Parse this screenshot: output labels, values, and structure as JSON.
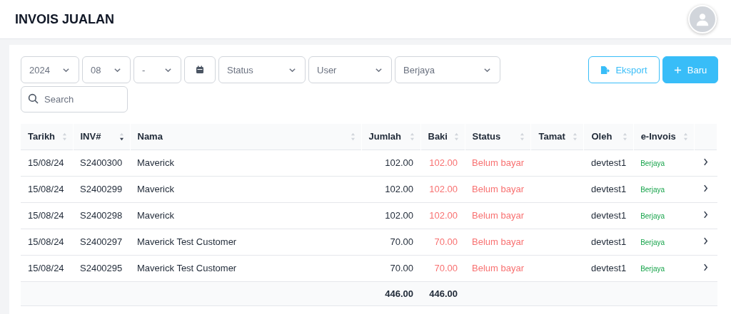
{
  "header": {
    "title": "INVOIS JUALAN"
  },
  "filters": [
    {
      "kind": "select",
      "value": "2024"
    },
    {
      "kind": "select",
      "value": "08"
    },
    {
      "kind": "select",
      "value": "-"
    },
    {
      "kind": "date"
    },
    {
      "kind": "select",
      "placeholder": "Status"
    },
    {
      "kind": "select",
      "placeholder": "User"
    },
    {
      "kind": "select",
      "value": "Berjaya"
    }
  ],
  "buttons": [
    {
      "kind": "outline",
      "label": "Eksport"
    },
    {
      "kind": "primary",
      "label": "Baru"
    }
  ],
  "search": {
    "placeholder": "Search"
  },
  "table": {
    "columns": [
      {
        "label": "Tarikh",
        "sorted_desc": false
      },
      {
        "label": "INV#",
        "sorted_desc": true
      },
      {
        "label": "Nama",
        "sorted_desc": false
      },
      {
        "label": "Jumlah",
        "sorted_desc": false
      },
      {
        "label": "Baki",
        "sorted_desc": false
      },
      {
        "label": "Status",
        "sorted_desc": false
      },
      {
        "label": "Tamat",
        "sorted_desc": false
      },
      {
        "label": "Oleh",
        "sorted_desc": false
      },
      {
        "label": "e-Invois",
        "sorted_desc": false
      }
    ],
    "rows": [
      {
        "tarikh": "15/08/24",
        "inv": "S2400300",
        "nama": "Maverick",
        "jumlah": "102.00",
        "baki": "102.00",
        "status": "Belum bayar",
        "paid": false,
        "oleh": "devtest1",
        "e_invois": "Berjaya"
      },
      {
        "tarikh": "15/08/24",
        "inv": "S2400299",
        "nama": "Maverick",
        "jumlah": "102.00",
        "baki": "102.00",
        "status": "Belum bayar",
        "paid": false,
        "oleh": "devtest1",
        "e_invois": "Berjaya"
      },
      {
        "tarikh": "15/08/24",
        "inv": "S2400298",
        "nama": "Maverick",
        "jumlah": "102.00",
        "baki": "102.00",
        "status": "Belum bayar",
        "paid": false,
        "oleh": "devtest1",
        "e_invois": "Berjaya"
      },
      {
        "tarikh": "15/08/24",
        "inv": "S2400297",
        "nama": "Maverick Test Customer",
        "jumlah": "70.00",
        "baki": "70.00",
        "status": "Belum bayar",
        "paid": false,
        "oleh": "devtest1",
        "e_invois": "Berjaya"
      },
      {
        "tarikh": "15/08/24",
        "inv": "S2400295",
        "nama": "Maverick Test Customer",
        "jumlah": "70.00",
        "baki": "70.00",
        "status": "Belum bayar",
        "paid": false,
        "oleh": "devtest1",
        "e_invois": "Berjaya"
      }
    ],
    "totals": {
      "jumlah": "446.00",
      "baki": "446.00"
    }
  }
}
